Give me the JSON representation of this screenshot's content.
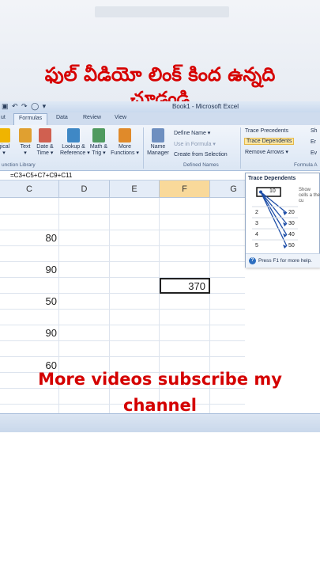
{
  "headline": {
    "line1": "ఫుల్ వీడియో లింక్ కింద ఉన్నది",
    "line2": "చూడండి"
  },
  "excel": {
    "window_title": "Book1 - Microsoft Excel",
    "qat_glyphs": "▣ ↶ ↷ ◯ ▾",
    "tabs": [
      "ut",
      "Formulas",
      "Data",
      "Review",
      "View"
    ],
    "ribbon": {
      "buttons": [
        {
          "label": "gical\n▾",
          "icon": "logical-icon",
          "color": "#f0b400"
        },
        {
          "label": "Text\n▾",
          "icon": "text-function-icon",
          "color": "#e0a030"
        },
        {
          "label": "Date &\nTime ▾",
          "icon": "date-time-icon",
          "color": "#d06050"
        },
        {
          "label": "Lookup &\nReference ▾",
          "icon": "lookup-icon",
          "color": "#3f88c5"
        },
        {
          "label": "Math &\nTrig ▾",
          "icon": "math-trig-icon",
          "color": "#4f9a5f"
        },
        {
          "label": "More\nFunctions ▾",
          "icon": "more-functions-icon",
          "color": "#e08a2a"
        },
        {
          "label": "Name\nManager",
          "icon": "name-manager-icon",
          "color": "#6e8fc0"
        }
      ],
      "define_name": "Define Name ▾",
      "use_in_formula": "Use in Formula ▾",
      "create_from_selection": "Create from Selection",
      "group_function_library": "unction Library",
      "group_defined_names": "Defined Names",
      "trace_precedents": "Trace Precedents",
      "trace_dependents": "Trace Dependents",
      "remove_arrows": "Remove Arrows ▾",
      "group_formula_auditing": "Formula A",
      "clipped_right": [
        "Sh",
        "Er",
        "Ev"
      ]
    },
    "formula_bar": "=C3+C5+C7+C9+C11",
    "columns": [
      "C",
      "D",
      "E",
      "F",
      "G"
    ],
    "cells_c": [
      "80",
      "90",
      "50",
      "90",
      "60"
    ],
    "active_cell_value": "370",
    "tooltip": {
      "title": "Trace Dependents",
      "desc": "Show cells a the cu",
      "help": "Press F1 for more help.",
      "mini_rows": [
        {
          "row": "",
          "val": "10"
        },
        {
          "row": "2",
          "val": "20"
        },
        {
          "row": "3",
          "val": "30"
        },
        {
          "row": "4",
          "val": "40"
        },
        {
          "row": "5",
          "val": "50"
        }
      ]
    }
  },
  "overlay": {
    "line1": "More videos subscribe my",
    "line2": "channel"
  }
}
